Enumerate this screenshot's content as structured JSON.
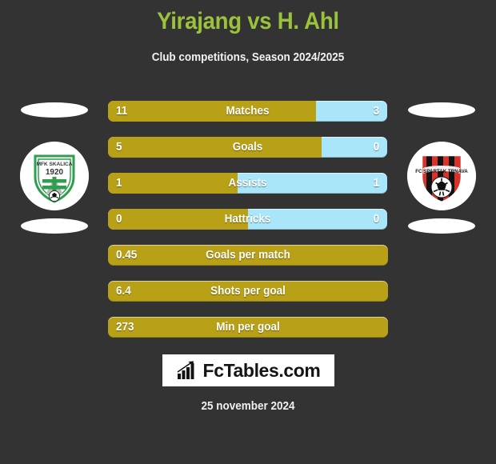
{
  "header": {
    "title": "Yirajang vs H. Ahl",
    "subtitle": "Club competitions, Season 2024/2025",
    "title_color": "#9ac23c"
  },
  "colors": {
    "background": "#333333",
    "home_bar": "#b9a117",
    "away_bar": "#a9e6fa",
    "text": "#ffffff"
  },
  "teams": {
    "home": {
      "logo_name": "mfk-skalica-crest",
      "crest_text": "MFK SKALICA",
      "crest_year": "1920"
    },
    "away": {
      "logo_name": "fc-spartak-trnava-crest",
      "crest_text": "FC SPARTAK TRNAVA"
    }
  },
  "chart_data": {
    "type": "bar",
    "title": "Yirajang vs H. Ahl",
    "subtitle": "Club competitions, Season 2024/2025",
    "orientation": "horizontal-diverging",
    "series": [
      {
        "name": "Yirajang",
        "color": "#b9a117"
      },
      {
        "name": "H. Ahl",
        "color": "#a9e6fa"
      }
    ],
    "rows": [
      {
        "label": "Matches",
        "home": "11",
        "away": "3",
        "home_pct": 74.5,
        "split": true
      },
      {
        "label": "Goals",
        "home": "5",
        "away": "0",
        "home_pct": 76.5,
        "split": true
      },
      {
        "label": "Assists",
        "home": "1",
        "away": "1",
        "home_pct": 46.5,
        "split": true
      },
      {
        "label": "Hattricks",
        "home": "0",
        "away": "0",
        "home_pct": 50.0,
        "split": true
      },
      {
        "label": "Goals per match",
        "home": "0.45",
        "away": "",
        "home_pct": 100,
        "split": false
      },
      {
        "label": "Shots per goal",
        "home": "6.4",
        "away": "",
        "home_pct": 100,
        "split": false
      },
      {
        "label": "Min per goal",
        "home": "273",
        "away": "",
        "home_pct": 100,
        "split": false
      }
    ]
  },
  "footer": {
    "logo_text": "FcTables.com",
    "logo_icon": "bar-chart-growth-icon",
    "date": "25 november 2024"
  }
}
